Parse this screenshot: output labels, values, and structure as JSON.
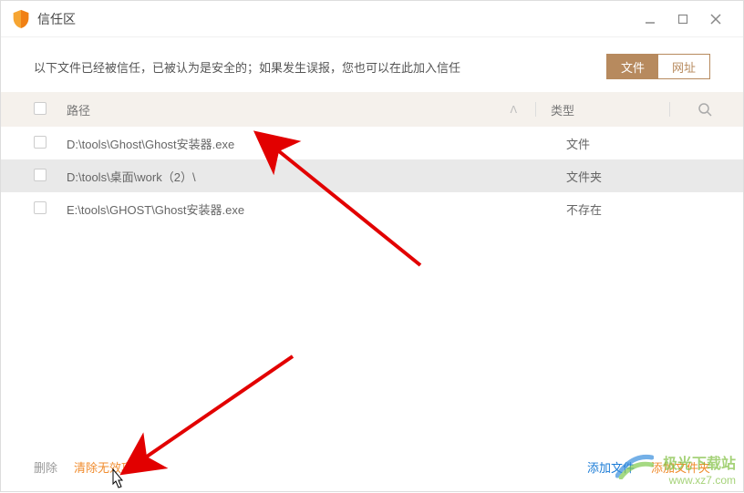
{
  "window": {
    "title": "信任区"
  },
  "info": {
    "text": "以下文件已经被信任，已被认为是安全的；如果发生误报，您也可以在此加入信任"
  },
  "tabs": {
    "file": "文件",
    "url": "网址"
  },
  "table": {
    "headers": {
      "path": "路径",
      "type": "类型"
    },
    "rows": [
      {
        "path": "D:\\tools\\Ghost\\Ghost安装器.exe",
        "type": "文件",
        "selected": false
      },
      {
        "path": "D:\\tools\\桌面\\work（2）\\",
        "type": "文件夹",
        "selected": true
      },
      {
        "path": "E:\\tools\\GHOST\\Ghost安装器.exe",
        "type": "不存在",
        "selected": false
      }
    ]
  },
  "footer": {
    "delete": "删除",
    "clear_invalid": "清除无效项",
    "add_file": "添加文件",
    "add_folder": "添加文件夹"
  },
  "watermark": {
    "brand": "极光下载站",
    "url": "www.xz7.com"
  }
}
